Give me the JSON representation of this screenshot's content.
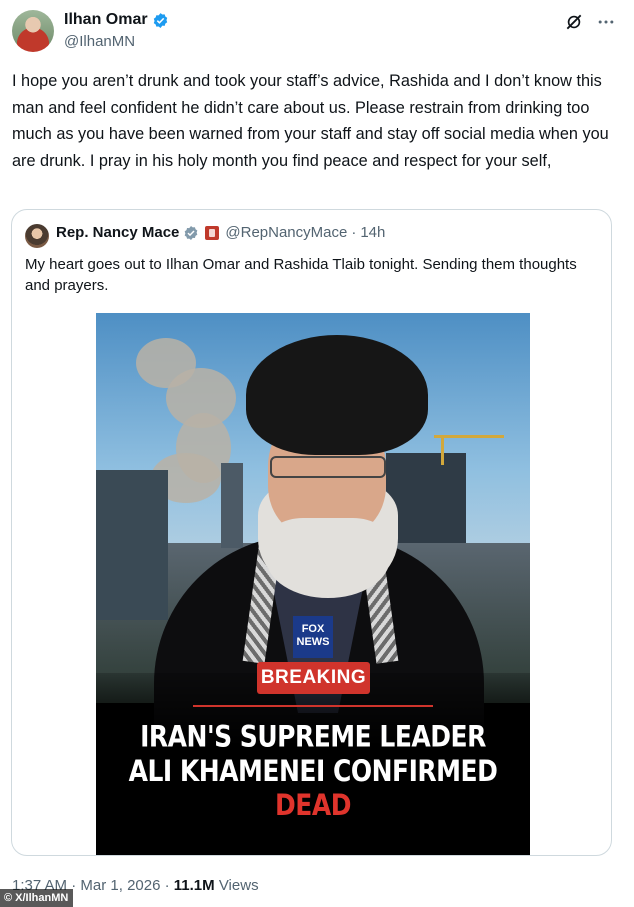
{
  "author": {
    "name": "Ilhan Omar",
    "handle": "@IlhanMN"
  },
  "tweet": {
    "text": "I hope you aren’t drunk and took your staff’s advice, Rashida and I don’t know this man and feel confident he didn’t care about us. Please restrain from drinking too much as you have been warned from your staff and stay off social media when you are drunk. I pray in his holy month you find peace and respect for your self,"
  },
  "quote": {
    "name": "Rep. Nancy Mace",
    "handle": "@RepNancyMace",
    "separator": "·",
    "time": "14h",
    "text": "My heart goes out to Ilhan Omar and Rashida Tlaib tonight. Sending them thoughts and prayers.",
    "media": {
      "logo_line1": "FOX",
      "logo_line2": "NEWS",
      "banner": "BREAKING",
      "headline_line1": "IRAN'S SUPREME LEADER",
      "headline_line2_main": "ALI KHAMENEI CONFIRMED",
      "headline_line2_emphasis": "DEAD"
    }
  },
  "meta": {
    "time": "1:37 AM",
    "dot": "·",
    "date": "Mar 1, 2026",
    "views_count": "11.1M",
    "views_label": "Views"
  },
  "watermark": "© X/IlhanMN",
  "icons": {
    "verified": "verified-badge-icon",
    "grok": "grok-icon",
    "more": "more-icon",
    "government": "government-badge-icon"
  },
  "colors": {
    "verified_blue": "#1d9bf0",
    "breaking_red": "#d0342c",
    "secondary_text": "#536471"
  }
}
